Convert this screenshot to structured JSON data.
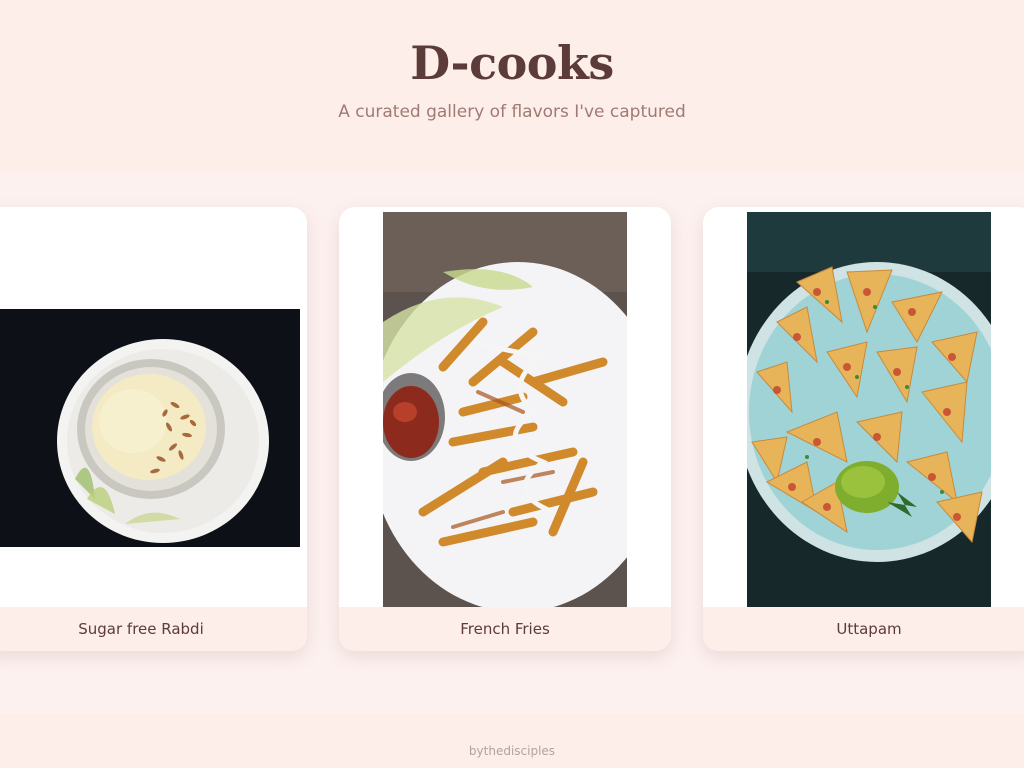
{
  "header": {
    "title": "D-cooks",
    "subtitle": "A curated gallery of flavors I've captured"
  },
  "gallery": {
    "cards": [
      {
        "caption": "Sugar free Rabdi",
        "image_icon": "rabdi-bowl-photo"
      },
      {
        "caption": "French Fries",
        "image_icon": "french-fries-photo"
      },
      {
        "caption": "Uttapam",
        "image_icon": "uttapam-photo"
      }
    ]
  },
  "footer": {
    "credit": "bythedisciples"
  },
  "colors": {
    "accent": "#5b3c38",
    "muted": "#a07a74",
    "header_bg": "#fdeeea"
  }
}
